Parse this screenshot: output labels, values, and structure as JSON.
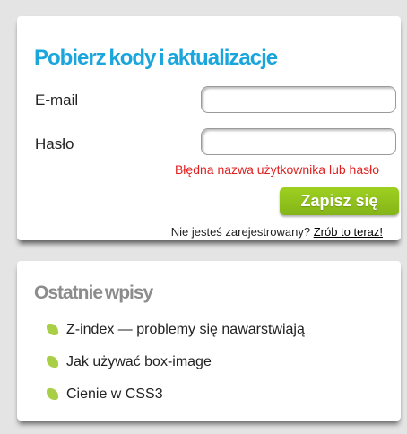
{
  "colors": {
    "title_blue": "#1aa6dc",
    "error_red": "#e02020",
    "button_green": "#9ed021",
    "button_green_dark": "#84b418",
    "bullet_green": "#a8cf45",
    "recent_title_gray": "#8c8c8c"
  },
  "login": {
    "title": "Pobierz kody i aktualizacje",
    "email_label": "E-mail",
    "email_value": "",
    "password_label": "Hasło",
    "password_value": "",
    "error_message": "Błędna nazwa użytkownika lub hasło",
    "save_label": "Zapisz się",
    "register_prompt": "Nie jesteś zarejestrowany? ",
    "register_link": "Zrób to teraz!"
  },
  "recent": {
    "title": "Ostatnie wpisy",
    "bullet_icon": "leaf-bullet-icon",
    "posts": [
      {
        "label": "Z-index — problemy się nawarstwiają"
      },
      {
        "label": "Jak używać box-image"
      },
      {
        "label": "Cienie w CSS3"
      }
    ]
  }
}
